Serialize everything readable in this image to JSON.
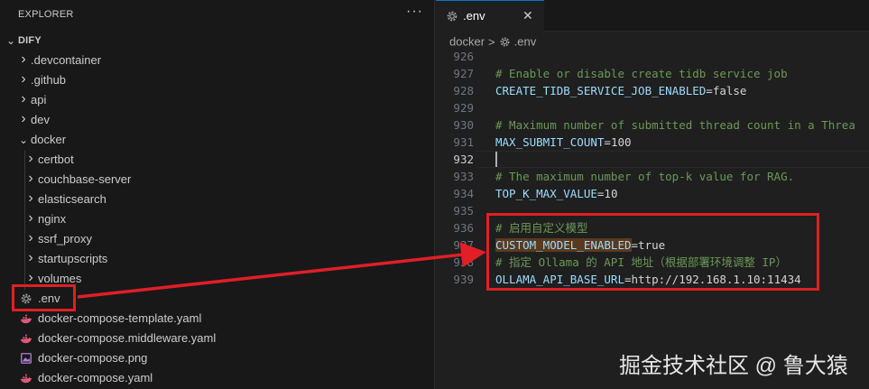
{
  "explorer": {
    "title": "EXPLORER",
    "more_actions": "···",
    "root": "DIFY",
    "items": [
      {
        "label": ".devcontainer",
        "kind": "folder",
        "expanded": false,
        "depth": 1
      },
      {
        "label": ".github",
        "kind": "folder",
        "expanded": false,
        "depth": 1
      },
      {
        "label": "api",
        "kind": "folder",
        "expanded": false,
        "depth": 1
      },
      {
        "label": "dev",
        "kind": "folder",
        "expanded": false,
        "depth": 1
      },
      {
        "label": "docker",
        "kind": "folder",
        "expanded": true,
        "depth": 1
      },
      {
        "label": "certbot",
        "kind": "folder",
        "expanded": false,
        "depth": 2
      },
      {
        "label": "couchbase-server",
        "kind": "folder",
        "expanded": false,
        "depth": 2
      },
      {
        "label": "elasticsearch",
        "kind": "folder",
        "expanded": false,
        "depth": 2
      },
      {
        "label": "nginx",
        "kind": "folder",
        "expanded": false,
        "depth": 2
      },
      {
        "label": "ssrf_proxy",
        "kind": "folder",
        "expanded": false,
        "depth": 2
      },
      {
        "label": "startupscripts",
        "kind": "folder",
        "expanded": false,
        "depth": 2
      },
      {
        "label": "volumes",
        "kind": "folder",
        "expanded": false,
        "depth": 2
      },
      {
        "label": ".env",
        "kind": "file",
        "icon": "gear-icon",
        "depth": 2
      },
      {
        "label": "docker-compose-template.yaml",
        "kind": "file",
        "icon": "docker-whale-icon",
        "depth": 2
      },
      {
        "label": "docker-compose.middleware.yaml",
        "kind": "file",
        "icon": "docker-whale-icon",
        "depth": 2
      },
      {
        "label": "docker-compose.png",
        "kind": "file",
        "icon": "image-file-icon",
        "depth": 2
      },
      {
        "label": "docker-compose.yaml",
        "kind": "file",
        "icon": "docker-whale-icon",
        "depth": 2
      }
    ]
  },
  "editor": {
    "tab": {
      "label": ".env",
      "close": "✕"
    },
    "breadcrumb": {
      "folder": "docker",
      "separator": ">",
      "file": ".env"
    },
    "active_line": "932",
    "lines": [
      {
        "n": "926",
        "kind": "empty",
        "text": ""
      },
      {
        "n": "927",
        "kind": "comment",
        "text": "# Enable or disable create tidb service job"
      },
      {
        "n": "928",
        "kind": "kv",
        "key": "CREATE_TIDB_SERVICE_JOB_ENABLED",
        "value": "false"
      },
      {
        "n": "929",
        "kind": "empty",
        "text": ""
      },
      {
        "n": "930",
        "kind": "comment",
        "text": "# Maximum number of submitted thread count in a Threa"
      },
      {
        "n": "931",
        "kind": "kv",
        "key": "MAX_SUBMIT_COUNT",
        "value": "100"
      },
      {
        "n": "932",
        "kind": "empty",
        "text": ""
      },
      {
        "n": "933",
        "kind": "comment",
        "text": "# The maximum number of top-k value for RAG."
      },
      {
        "n": "934",
        "kind": "kv",
        "key": "TOP_K_MAX_VALUE",
        "value": "10"
      },
      {
        "n": "935",
        "kind": "empty",
        "text": ""
      },
      {
        "n": "936",
        "kind": "comment",
        "text": "# 启用自定义模型"
      },
      {
        "n": "937",
        "kind": "kv",
        "key": "CUSTOM_MODEL_ENABLED",
        "value": "true"
      },
      {
        "n": "938",
        "kind": "comment",
        "text": "# 指定 Ollama 的 API 地址（根据部署环境调整 IP）"
      },
      {
        "n": "939",
        "kind": "kv",
        "key": "OLLAMA_API_BASE_URL",
        "value": "http://192.168.1.10:11434"
      }
    ]
  },
  "watermark": "掘金技术社区 @ 鲁大猿",
  "colors": {
    "annotation": "#e01f26",
    "comment": "#6a9955",
    "key": "#9cdcfe",
    "accent": "#0078d4"
  }
}
